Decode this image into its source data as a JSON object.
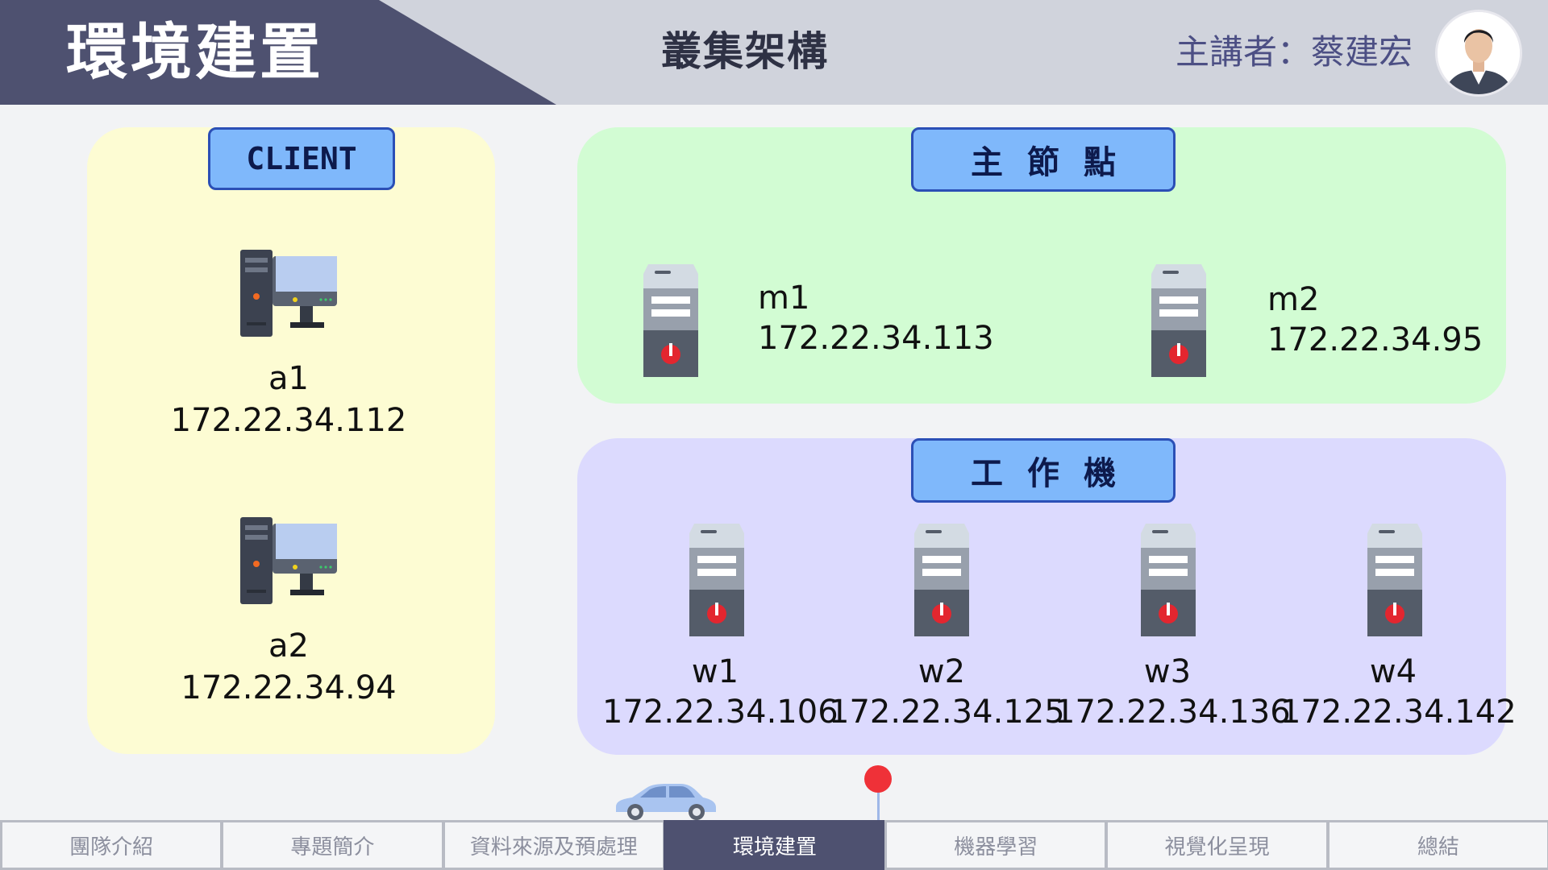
{
  "header": {
    "title": "環境建置",
    "subtitle": "叢集架構",
    "presenter": "主講者：蔡建宏"
  },
  "client_section": {
    "label": "CLIENT",
    "nodes": [
      {
        "name": "a1",
        "ip": "172.22.34.112"
      },
      {
        "name": "a2",
        "ip": "172.22.34.94"
      }
    ]
  },
  "master_section": {
    "label": "主節點",
    "nodes": [
      {
        "name": "m1",
        "ip": "172.22.34.113"
      },
      {
        "name": "m2",
        "ip": "172.22.34.95"
      }
    ]
  },
  "worker_section": {
    "label": "工作機",
    "nodes": [
      {
        "name": "w1",
        "ip": "172.22.34.106"
      },
      {
        "name": "w2",
        "ip": "172.22.34.125"
      },
      {
        "name": "w3",
        "ip": "172.22.34.136"
      },
      {
        "name": "w4",
        "ip": "172.22.34.142"
      }
    ]
  },
  "nav": {
    "active_index": 3,
    "items": [
      "團隊介紹",
      "專題簡介",
      "資料來源及預處理",
      "環境建置",
      "機器學習",
      "視覺化呈現",
      "總結"
    ]
  },
  "colors": {
    "header_dark": "#4e5170",
    "client_panel": "#fdfcd3",
    "master_panel": "#d2fcd3",
    "worker_panel": "#dcdafe",
    "label_fill": "#7fb8fb",
    "marker": "#ef3138"
  },
  "icons": {
    "client_node": "desktop-computer-icon",
    "server_node": "server-icon",
    "progress_marker": "car-icon",
    "progress_pin": "pin-icon"
  }
}
